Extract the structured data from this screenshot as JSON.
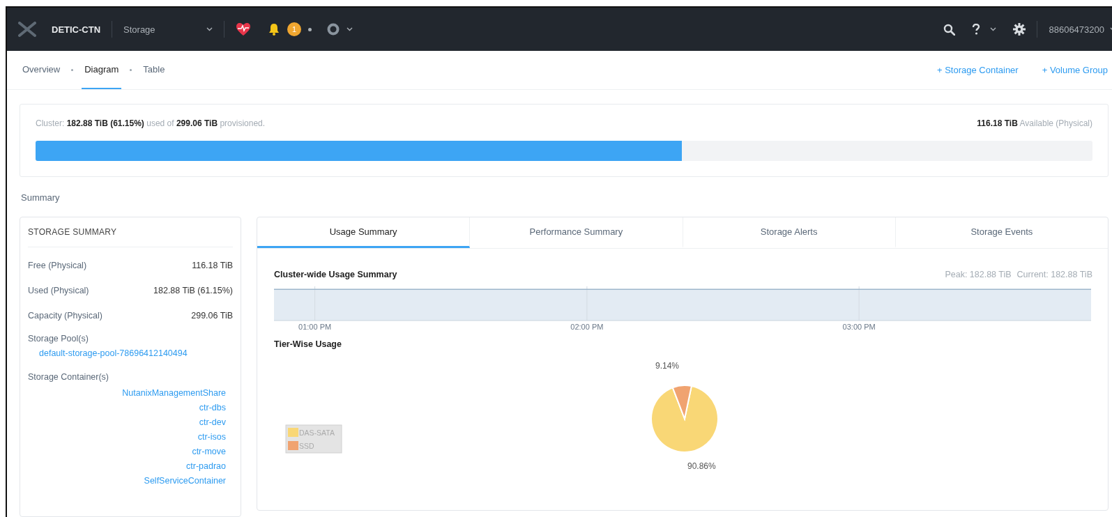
{
  "top_bar": {
    "cluster_name": "DETIC-CTN",
    "section": "Storage",
    "alert_count": "1",
    "user": "88606473200"
  },
  "nav": {
    "tabs": [
      {
        "label": "Overview",
        "selected": false
      },
      {
        "label": "Diagram",
        "selected": true
      },
      {
        "label": "Table",
        "selected": false
      }
    ],
    "actions": [
      "+ Storage Container",
      "+ Volume Group"
    ]
  },
  "cluster_usage": {
    "summary": "Cluster:  **182.88 TiB (61.15%)** used of **299.06 TiB** provisioned.",
    "available": "**116.18 TiB** Available (Physical)",
    "level": 0.6115
  },
  "section_label": "Summary",
  "storage_summary": {
    "title": "STORAGE SUMMARY",
    "rows": [
      {
        "label": "Free (Physical)",
        "value": "116.18 TiB"
      },
      {
        "label": "Used (Physical)",
        "value": "182.88 TiB (61.15%)"
      },
      {
        "label": "Capacity (Physical)",
        "value": "299.06 TiB"
      }
    ],
    "pools_label": "Storage Pool(s)",
    "pools": [
      "default-storage-pool-78696412140494"
    ],
    "containers_label": "Storage Container(s)",
    "containers": [
      "NutanixManagementShare",
      "ctr-dbs",
      "ctr-dev",
      "ctr-isos",
      "ctr-move",
      "ctr-padrao",
      "SelfServiceContainer"
    ]
  },
  "detail_tabs": [
    {
      "label": "Usage Summary",
      "selected": true
    },
    {
      "label": "Performance Summary",
      "selected": false
    },
    {
      "label": "Storage Alerts",
      "selected": false
    },
    {
      "label": "Storage Events",
      "selected": false
    }
  ],
  "usage_chart": {
    "title": "Cluster-wide Usage Summary",
    "peak": "Peak: 182.88 TiB",
    "current": "Current: 182.88 TiB",
    "time_labels": [
      "01:00 PM",
      "02:00 PM",
      "03:00 PM"
    ]
  },
  "tier_usage": {
    "title": "Tier-Wise Usage",
    "legend": [
      {
        "label": "DAS-SATA",
        "color": "#f9d776"
      },
      {
        "label": "SSD",
        "color": "#f0a370"
      }
    ],
    "chart_data": {
      "type": "pie",
      "values": [
        90.86,
        9.14
      ],
      "value_labels": [
        "90.86%",
        "9.14%"
      ]
    }
  }
}
